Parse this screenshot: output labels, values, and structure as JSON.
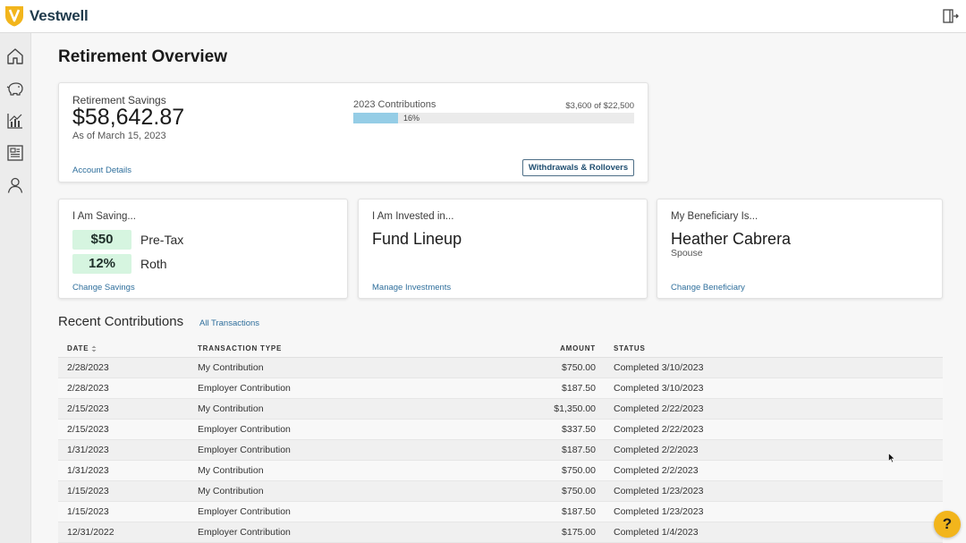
{
  "brand": {
    "name": "Vestwell",
    "accent": "#f2b51c",
    "logo_color": "#1f3a4b"
  },
  "header": {
    "exit_icon": "logout-icon"
  },
  "sidebar": {
    "items": [
      {
        "name": "home",
        "icon": "home-icon"
      },
      {
        "name": "savings",
        "icon": "piggy-bank-icon"
      },
      {
        "name": "investments",
        "icon": "chart-icon"
      },
      {
        "name": "documents",
        "icon": "newspaper-icon"
      },
      {
        "name": "profile",
        "icon": "person-icon"
      }
    ]
  },
  "page": {
    "title": "Retirement Overview"
  },
  "savings": {
    "label": "Retirement Savings",
    "amount": "$58,642.87",
    "as_of": "As of March 15, 2023",
    "link": "Account Details",
    "contrib_label": "2023 Contributions",
    "contrib_of": "$3,600 of $22,500",
    "progress_percent": 16,
    "progress_label": "16%",
    "button": "Withdrawals & Rollovers"
  },
  "saving_card": {
    "title": "I Am Saving...",
    "rows": [
      {
        "value": "$50",
        "label": "Pre-Tax"
      },
      {
        "value": "12%",
        "label": "Roth"
      }
    ],
    "link": "Change Savings"
  },
  "invested_card": {
    "title": "I Am Invested in...",
    "value": "Fund Lineup",
    "link": "Manage Investments"
  },
  "beneficiary_card": {
    "title": "My Beneficiary Is...",
    "name": "Heather Cabrera",
    "relation": "Spouse",
    "link": "Change Beneficiary"
  },
  "recent": {
    "title": "Recent Contributions",
    "link": "All Transactions",
    "columns": {
      "date": "DATE",
      "type": "TRANSACTION TYPE",
      "amount": "AMOUNT",
      "status": "STATUS"
    },
    "rows": [
      {
        "date": "2/28/2023",
        "type": "My Contribution",
        "amount": "$750.00",
        "status": "Completed 3/10/2023"
      },
      {
        "date": "2/28/2023",
        "type": "Employer Contribution",
        "amount": "$187.50",
        "status": "Completed 3/10/2023"
      },
      {
        "date": "2/15/2023",
        "type": "My Contribution",
        "amount": "$1,350.00",
        "status": "Completed 2/22/2023"
      },
      {
        "date": "2/15/2023",
        "type": "Employer Contribution",
        "amount": "$337.50",
        "status": "Completed 2/22/2023"
      },
      {
        "date": "1/31/2023",
        "type": "Employer Contribution",
        "amount": "$187.50",
        "status": "Completed 2/2/2023"
      },
      {
        "date": "1/31/2023",
        "type": "My Contribution",
        "amount": "$750.00",
        "status": "Completed 2/2/2023"
      },
      {
        "date": "1/15/2023",
        "type": "My Contribution",
        "amount": "$750.00",
        "status": "Completed 1/23/2023"
      },
      {
        "date": "1/15/2023",
        "type": "Employer Contribution",
        "amount": "$187.50",
        "status": "Completed 1/23/2023"
      },
      {
        "date": "12/31/2022",
        "type": "Employer Contribution",
        "amount": "$175.00",
        "status": "Completed 1/4/2023"
      }
    ]
  },
  "help": {
    "label": "?"
  }
}
